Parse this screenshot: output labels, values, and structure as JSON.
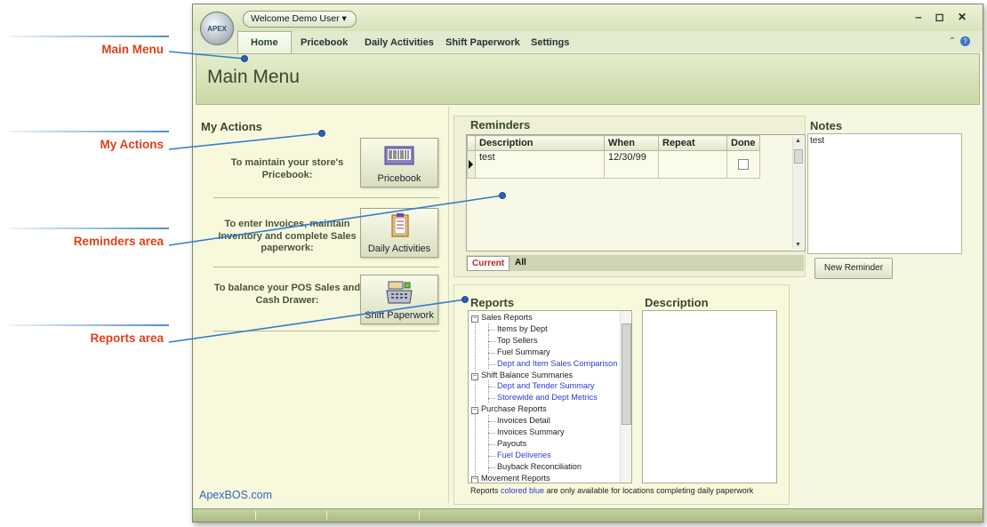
{
  "annotations": [
    {
      "label": "Main Menu"
    },
    {
      "label": "My Actions"
    },
    {
      "label": "Reminders area"
    },
    {
      "label": "Reports area"
    }
  ],
  "window": {
    "logo_text": "APEX",
    "user_menu": "Welcome Demo User ▾",
    "controls": "‒ ◻ ✕"
  },
  "tabs": [
    "Home",
    "Pricebook",
    "Daily Activities",
    "Shift Paperwork",
    "Settings"
  ],
  "page_title": "Main Menu",
  "my_actions": {
    "title": "My Actions",
    "items": [
      {
        "text": "To maintain your store's Pricebook:",
        "button": "Pricebook",
        "icon": "barcode-scanner-icon"
      },
      {
        "text": "To enter Invoices, maintain Inventory and complete Sales paperwork:",
        "button": "Daily Activities",
        "icon": "clipboard-icon"
      },
      {
        "text": "To balance your POS Sales and Cash Drawer:",
        "button": "Shift Paperwork",
        "icon": "cash-register-icon"
      }
    ]
  },
  "reminders": {
    "title": "Reminders",
    "columns": [
      "Description",
      "When",
      "Repeat",
      "Done"
    ],
    "rows": [
      {
        "description": "test",
        "when": "12/30/99",
        "repeat": "",
        "done": false
      }
    ],
    "tabs": {
      "current": "Current",
      "all": "All"
    }
  },
  "notes": {
    "title": "Notes",
    "text": "test",
    "new_button": "New Reminder"
  },
  "reports": {
    "title": "Reports",
    "description_title": "Description",
    "tree": [
      {
        "label": "Sales Reports",
        "level": 0,
        "blue": false
      },
      {
        "label": "Items by Dept",
        "level": 1,
        "blue": false
      },
      {
        "label": "Top Sellers",
        "level": 1,
        "blue": false
      },
      {
        "label": "Fuel Summary",
        "level": 1,
        "blue": false
      },
      {
        "label": "Dept and Item Sales Comparison",
        "level": 1,
        "blue": true
      },
      {
        "label": "Shift Balance Summaries",
        "level": 0,
        "blue": false
      },
      {
        "label": "Dept and Tender Summary",
        "level": 1,
        "blue": true
      },
      {
        "label": "Storewide and Dept Metrics",
        "level": 1,
        "blue": true
      },
      {
        "label": "Purchase Reports",
        "level": 0,
        "blue": false
      },
      {
        "label": "Invoices Detail",
        "level": 1,
        "blue": false
      },
      {
        "label": "Invoices Summary",
        "level": 1,
        "blue": false
      },
      {
        "label": "Payouts",
        "level": 1,
        "blue": false
      },
      {
        "label": "Fuel Deliveries",
        "level": 1,
        "blue": true
      },
      {
        "label": "Buyback Reconciliation",
        "level": 1,
        "blue": false
      },
      {
        "label": "Movement Reports",
        "level": 0,
        "blue": false
      }
    ],
    "note_pre": "Reports",
    "note_blue": "colored blue",
    "note_post": "are only available for locations completing daily paperwork"
  },
  "footer_link": "ApexBOS.com",
  "colors": {
    "callout": "#e0401a",
    "accent_blue": "#2f63c6",
    "link_blue": "#2b3bd6",
    "panel": "#f8f8dc",
    "header": "#c9d7a6"
  }
}
